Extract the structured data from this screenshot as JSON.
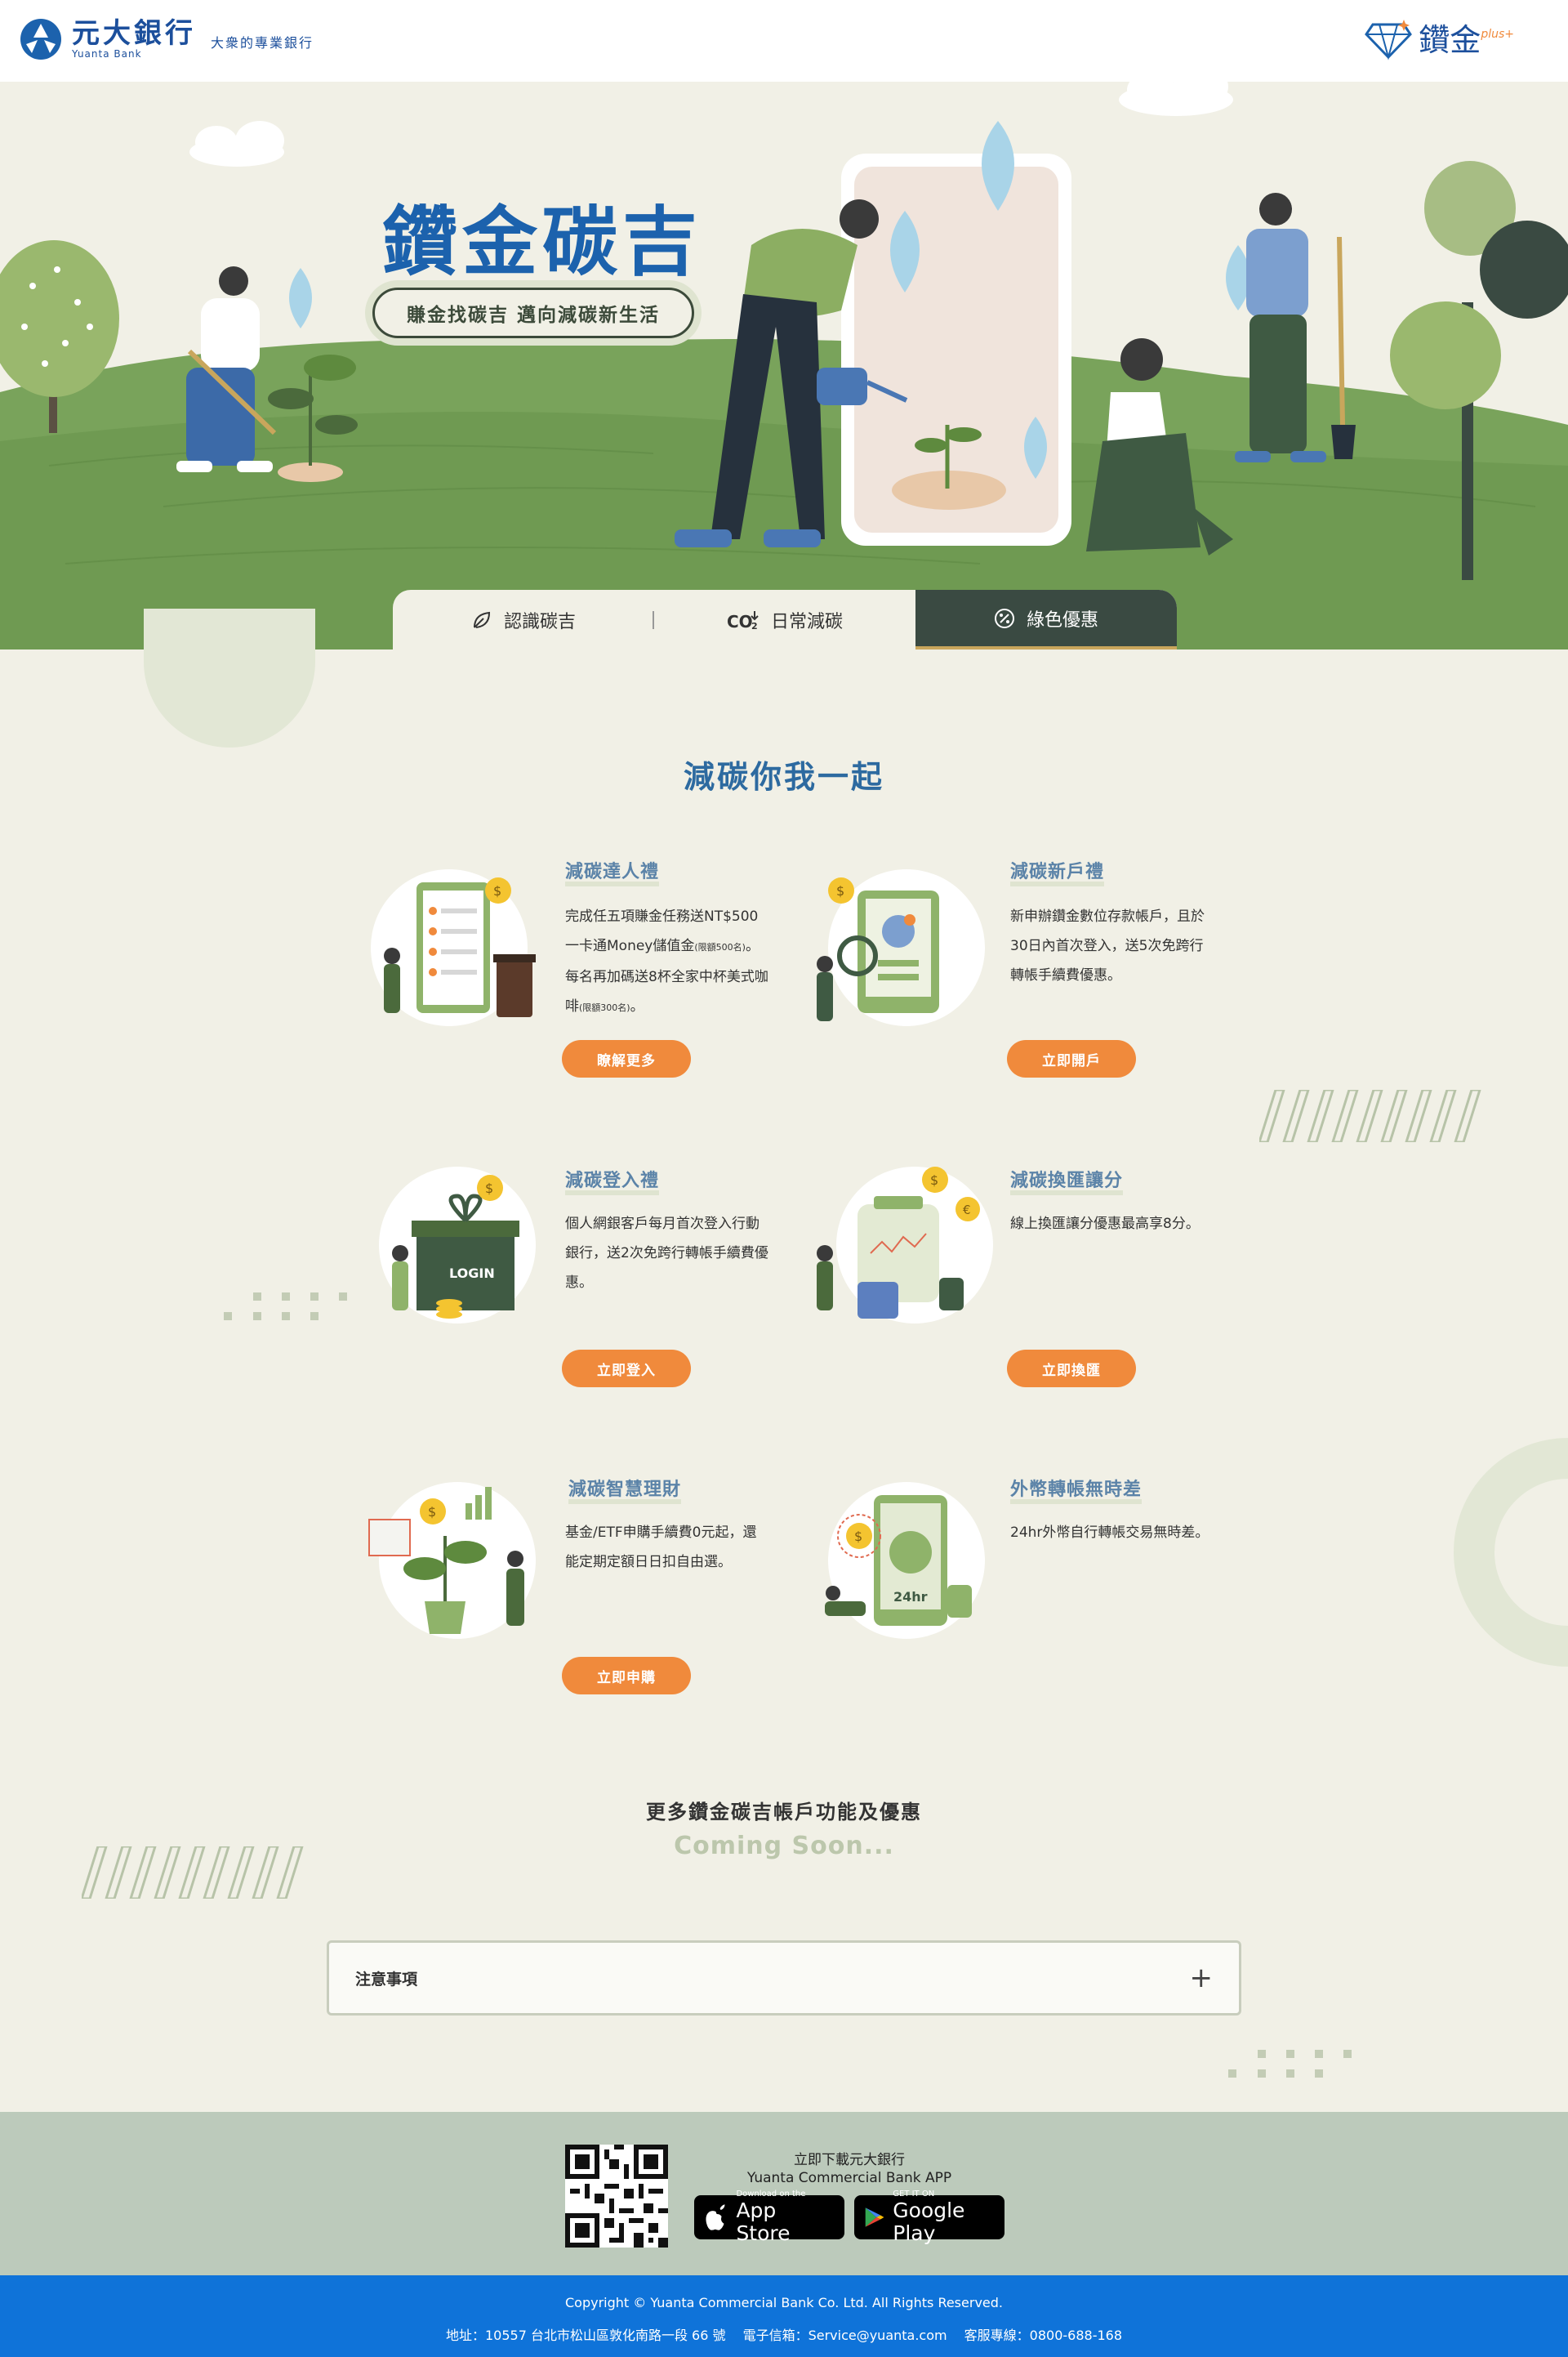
{
  "header": {
    "bank_name_cn": "元大銀行",
    "bank_name_en": "Yuanta Bank",
    "slogan": "大衆的專業銀行",
    "plus_logo_cn": "鑽金",
    "plus_logo_sup": "plus+"
  },
  "hero": {
    "title": "鑽金碳吉",
    "subtitle": "賺金找碳吉 邁向減碳新生活",
    "tabs": [
      {
        "label": "認識碳吉",
        "icon": "leaf-icon",
        "active": false
      },
      {
        "label": "日常減碳",
        "icon": "co2-icon",
        "active": false
      },
      {
        "label": "綠色優惠",
        "icon": "percent-icon",
        "active": true
      }
    ]
  },
  "main": {
    "title": "減碳你我一起",
    "cards": [
      {
        "title": "減碳達人禮",
        "desc_parts": [
          "完成任五項賺金任務送NT$500一卡通Money儲值金",
          "(限額500名)",
          "。每名再加碼送8杯全家中杯美式咖啡",
          "(限額300名)",
          "。"
        ],
        "button": "瞭解更多"
      },
      {
        "title": "減碳新戶禮",
        "desc": "新申辦鑽金數位存款帳戶，且於30日內首次登入，送5次免跨行轉帳手續費優惠。",
        "button": "立即開戶"
      },
      {
        "title": "減碳登入禮",
        "desc": "個人網銀客戶每月首次登入行動銀行，送2次免跨行轉帳手續費優惠。",
        "button": "立即登入",
        "illustration_text": "LOGIN"
      },
      {
        "title": "減碳換匯讓分",
        "desc": "線上換匯讓分優惠最高享8分。",
        "button": "立即換匯"
      },
      {
        "title": "減碳智慧理財",
        "desc": "基金/ETF申購手續費0元起，還能定期定額日日扣自由選。",
        "button": "立即申購"
      },
      {
        "title": "外幣轉帳無時差",
        "desc": "24hr外幣自行轉帳交易無時差。",
        "button": null,
        "illustration_text": "24hr"
      }
    ],
    "more_title": "更多鑽金碳吉帳戶功能及優惠",
    "more_subtitle": "Coming Soon...",
    "notice_label": "注意事項"
  },
  "footer": {
    "app_line1": "立即下載元大銀行",
    "app_line2": "Yuanta Commercial Bank APP",
    "appstore_small": "Download on the",
    "appstore_large": "App Store",
    "googleplay_small": "GET IT ON",
    "googleplay_large": "Google Play",
    "copyright": "Copyright © Yuanta Commercial Bank Co. Ltd. All Rights Reserved.",
    "address": "地址：10557 台北市松山區敦化南路一段 66 號　 電子信箱：Service@yuanta.com　 客服專線：0800-688-168"
  },
  "colors": {
    "accent_orange": "#f08a3c",
    "brand_blue": "#1c62ad",
    "active_tab": "#3a4a42",
    "footer_blue": "#0f73d9",
    "grass_green": "#6f9a52"
  }
}
